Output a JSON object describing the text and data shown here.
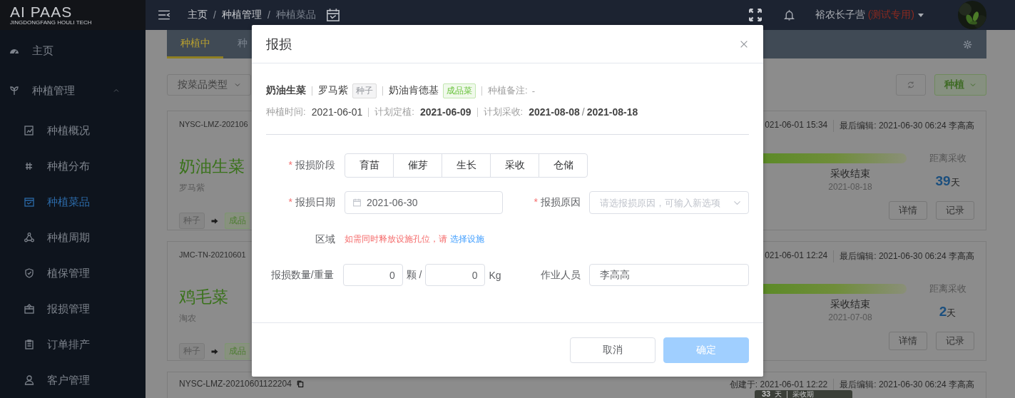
{
  "header": {
    "logo": "AI PAAS",
    "logo_subtitle": "JINGDONGFANG HOULI TECH",
    "breadcrumb_separator": "/",
    "breadcrumb": [
      {
        "label": "主页",
        "current": false
      },
      {
        "label": "种植管理",
        "current": false
      },
      {
        "label": "种植菜品",
        "current": true
      }
    ],
    "user": {
      "name": "裕农长子营",
      "note": "(测试专用)"
    }
  },
  "sidebar": {
    "items": [
      {
        "label": "主页",
        "selected": false
      },
      {
        "label": "种植管理",
        "expanded": true,
        "children": [
          {
            "label": "种植概况",
            "selected": false
          },
          {
            "label": "种植分布",
            "selected": false
          },
          {
            "label": "种植菜品",
            "selected": true
          },
          {
            "label": "种植周期",
            "selected": false
          },
          {
            "label": "植保管理",
            "selected": false
          },
          {
            "label": "报损管理",
            "selected": false
          },
          {
            "label": "订单排产",
            "selected": false
          },
          {
            "label": "客户管理",
            "selected": false
          }
        ]
      }
    ]
  },
  "tabs": [
    {
      "label": "种植中",
      "selected": true
    },
    {
      "label": "种",
      "selected": false
    }
  ],
  "toolbar": {
    "filter": {
      "placeholder": "按菜品类型"
    },
    "plant_button": "种植"
  },
  "cards": [
    {
      "kind": "full",
      "code": "NYSC-LMZ-202106",
      "name": "奶油生菜",
      "variety": "罗马紫",
      "tags": [
        {
          "label": "种子",
          "kind": "seed"
        },
        {
          "label": "成品",
          "kind": "product"
        }
      ],
      "created": "021-06-01 15:34",
      "edited": "最后编辑: 2021-06-30 06:24 李高高",
      "milestone": "采收结束",
      "milestone_date": "2021-08-18",
      "countdown_label": "距离采收",
      "countdown": "39",
      "countdown_unit": "天",
      "buttons": [
        "详情",
        "记录"
      ]
    },
    {
      "kind": "full",
      "code": "JMC-TN-20210601",
      "name": "鸡毛菜",
      "variety": "淘农",
      "tags": [
        {
          "label": "种子",
          "kind": "seed"
        },
        {
          "label": "成品",
          "kind": "product"
        }
      ],
      "created": "021-06-01 12:24",
      "edited": "最后编辑: 2021-06-30 06:24 李高高",
      "milestone": "采收结束",
      "milestone_date": "2021-07-08",
      "countdown_label": "距离采收",
      "countdown": "2",
      "countdown_unit": "天",
      "buttons": [
        "详情",
        "记录"
      ]
    },
    {
      "kind": "header_only",
      "code": "NYSC-LMZ-20210601122204",
      "created": "创建于: 2021-06-01 12:22",
      "edited": "最后编辑: 2021-06-30 06:24 李高高"
    }
  ],
  "float_badge": {
    "value": "33",
    "unit": "天",
    "separator": "|",
    "label": "采收期"
  },
  "dialog": {
    "title": "报损",
    "summary": {
      "crop": "奶油生菜",
      "variety": "罗马紫",
      "variety_tag": "种子",
      "product": "奶油肯德基",
      "product_tag": "成品菜",
      "note_label": "种植备注:",
      "note": "-"
    },
    "dates": [
      {
        "label": "种植时间:",
        "value": "2021-06-01",
        "bold": false
      },
      {
        "label": "计划定植:",
        "value": "2021-06-09",
        "bold": true
      },
      {
        "label": "计划采收:",
        "value": "2021-08-08",
        "separator": "/",
        "value2": "2021-08-18",
        "bold": true
      }
    ],
    "stage": {
      "mark": "*",
      "label": "报损阶段",
      "options": [
        {
          "label": "育苗",
          "selected": false
        },
        {
          "label": "催芽",
          "selected": false
        },
        {
          "label": "生长",
          "selected": false
        },
        {
          "label": "采收",
          "selected": false
        },
        {
          "label": "仓储",
          "selected": false
        }
      ]
    },
    "date": {
      "mark": "*",
      "label": "报损日期",
      "value": "2021-06-30"
    },
    "reason": {
      "mark": "*",
      "label": "报损原因",
      "placeholder": "请选报损原因，可输入新选项"
    },
    "area": {
      "label": "区域",
      "hint": "如需同时释放设施孔位，请",
      "link": "选择设施"
    },
    "quantity": {
      "label": "报损数量/重量",
      "count": "0",
      "count_unit": "颗 /",
      "weight": "0",
      "weight_unit": "Kg"
    },
    "operator": {
      "label": "作业人员",
      "value": "李高高"
    },
    "buttons": [
      {
        "label": "取消",
        "kind": "default",
        "disabled": false
      },
      {
        "label": "确定",
        "kind": "primary",
        "disabled": true
      }
    ]
  }
}
